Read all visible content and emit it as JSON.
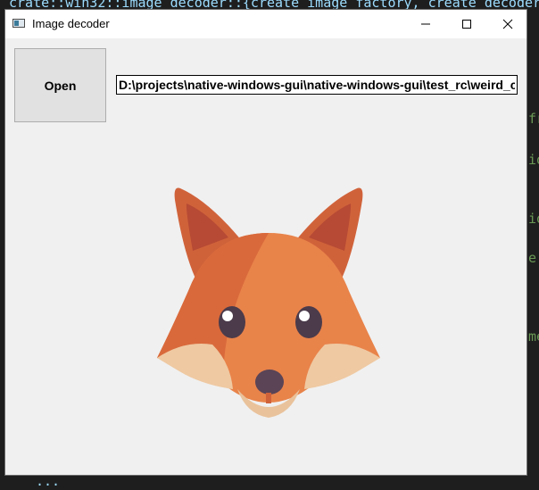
{
  "background": {
    "code_top": "crate::win32::image_decoder::{create_image_factory, create_decoder_f",
    "code_bottom": "...",
    "side_snippets": [
      "fr",
      "io",
      "io",
      "e.",
      "me"
    ]
  },
  "window": {
    "title": "Image decoder",
    "controls": {
      "minimize": "minimize-icon",
      "maximize": "maximize-icon",
      "close": "close-icon"
    }
  },
  "toolbar": {
    "open_label": "Open",
    "path_value": "D:\\projects\\native-windows-gui\\native-windows-gui\\test_rc\\weird_cat.png"
  },
  "image": {
    "subject": "fox-image"
  },
  "colors": {
    "window_bg": "#f0f0f0",
    "titlebar_bg": "#ffffff",
    "fox_main": "#e8834a",
    "fox_dark": "#d0623a"
  }
}
